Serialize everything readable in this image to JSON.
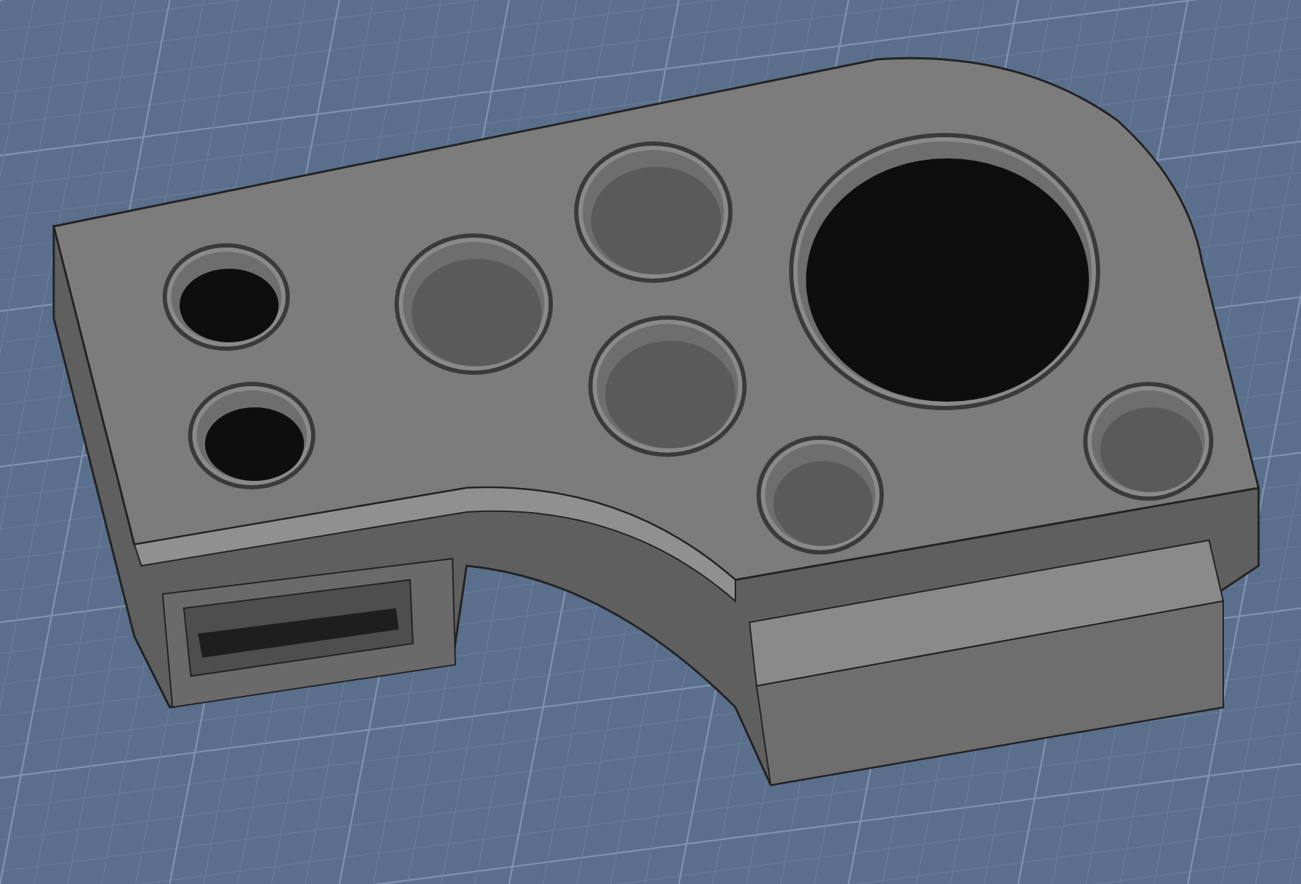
{
  "viewport": {
    "kind": "cad-model"
  }
}
